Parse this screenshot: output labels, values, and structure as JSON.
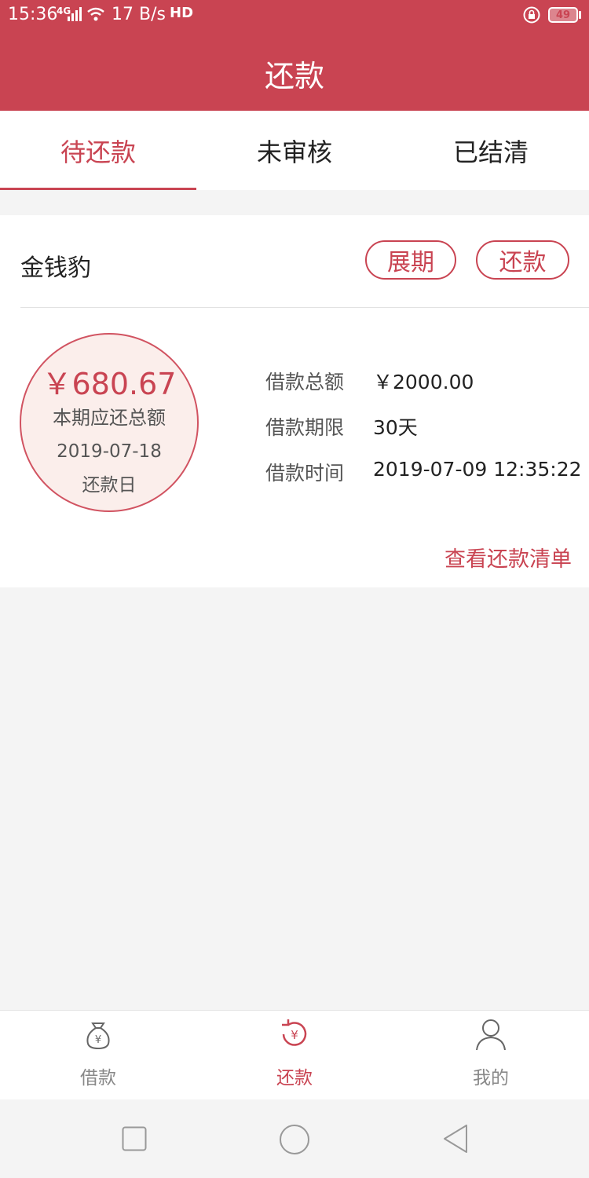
{
  "status_bar": {
    "time": "15:36",
    "network": "4G",
    "speed": "17 B/s",
    "hd": "HD",
    "battery": "49"
  },
  "header": {
    "title": "还款"
  },
  "tabs": [
    {
      "label": "待还款",
      "active": true
    },
    {
      "label": "未审核",
      "active": false
    },
    {
      "label": "已结清",
      "active": false
    }
  ],
  "loan_card": {
    "lender": "金钱豹",
    "extend_button": "展期",
    "repay_button": "还款",
    "amount_due": "￥680.67",
    "amount_due_label": "本期应还总额",
    "due_date": "2019-07-18",
    "due_date_label": "还款日",
    "details": [
      {
        "label": "借款总额",
        "value": "￥2000.00"
      },
      {
        "label": "借款期限",
        "value": "30天"
      },
      {
        "label": "借款时间",
        "value": "2019-07-09 12:35:22"
      }
    ],
    "view_schedule_link": "查看还款清单"
  },
  "bottom_nav": [
    {
      "label": "借款",
      "icon": "money-bag-icon",
      "active": false
    },
    {
      "label": "还款",
      "icon": "repay-cycle-icon",
      "active": true
    },
    {
      "label": "我的",
      "icon": "user-icon",
      "active": false
    }
  ],
  "colors": {
    "accent": "#c94452",
    "background": "#f4f4f4",
    "circle_fill": "#fbeeeb"
  }
}
